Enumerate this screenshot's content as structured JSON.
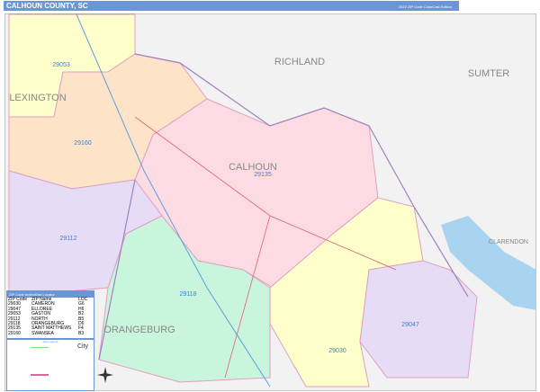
{
  "header": {
    "title": "CALHOUN COUNTY, SC",
    "subtitle": "2022 ZIP Code ColorCast Edition",
    "logo": "Marketmaps"
  },
  "map": {
    "counties": [
      {
        "name": "RICHLAND"
      },
      {
        "name": "SUMTER"
      },
      {
        "name": "LEXINGTON"
      },
      {
        "name": "CALHOUN"
      },
      {
        "name": "CLARENDON"
      },
      {
        "name": "ORANGEBURG"
      }
    ],
    "zips": [
      {
        "zip": "29053",
        "color": "#ffffcc"
      },
      {
        "zip": "29160",
        "color": "#fde3c8"
      },
      {
        "zip": "29135",
        "color": "#fddbe3"
      },
      {
        "zip": "29112",
        "color": "#e6dcf5"
      },
      {
        "zip": "29118",
        "color": "#c9f5dd"
      },
      {
        "zip": "29030",
        "color": "#ffffcc"
      },
      {
        "zip": "29047",
        "color": "#e6dcf5"
      }
    ],
    "water_color": "#a8d4f0"
  },
  "legend": {
    "title": "ZIP Code Index/Grid Locator",
    "headers": [
      "ZIP Code",
      "ZIP Name",
      "LOC"
    ],
    "rows": [
      [
        "29030",
        "CAMERON",
        "G6"
      ],
      [
        "29047",
        "ELLOREE",
        "H6"
      ],
      [
        "29053",
        "GASTON",
        "B2"
      ],
      [
        "29112",
        "NORTH",
        "B5"
      ],
      [
        "29118",
        "ORANGEBURG",
        "D6"
      ],
      [
        "29135",
        "SAINT MATTHEWS",
        "F4"
      ],
      [
        "29160",
        "SWANSEA",
        "B3"
      ]
    ],
    "key_title": "Map Legend",
    "city_label": "City"
  }
}
